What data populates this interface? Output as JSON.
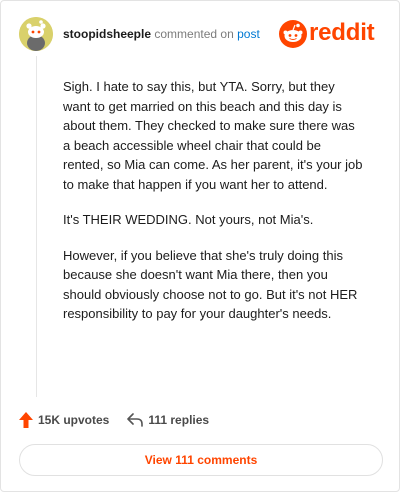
{
  "comment": {
    "username": "stoopidsheeple",
    "action_text": "commented on",
    "post_link": "post",
    "paragraphs": [
      "Sigh. I hate to say this, but YTA. Sorry, but they want to get married on this beach and this day is about them. They checked to make sure there was a beach accessible wheel chair that could be rented, so Mia can come. As her parent, it's your job to make that happen if you want her to attend.",
      "It's THEIR WEDDING. Not yours, not Mia's.",
      "However, if you believe that she's truly doing this because she doesn't want Mia there, then you should obviously choose not to go. But it's not HER responsibility to pay for your daughter's needs."
    ]
  },
  "brand": {
    "logo_text": "reddit",
    "accent_color": "#ff4500",
    "link_color": "#0079d3"
  },
  "actions": {
    "upvotes": "15K upvotes",
    "replies": "111 replies",
    "upvote_icon": "arrow-up-icon",
    "reply_icon": "reply-arrow-icon"
  },
  "view_comments_label": "View 111 comments"
}
